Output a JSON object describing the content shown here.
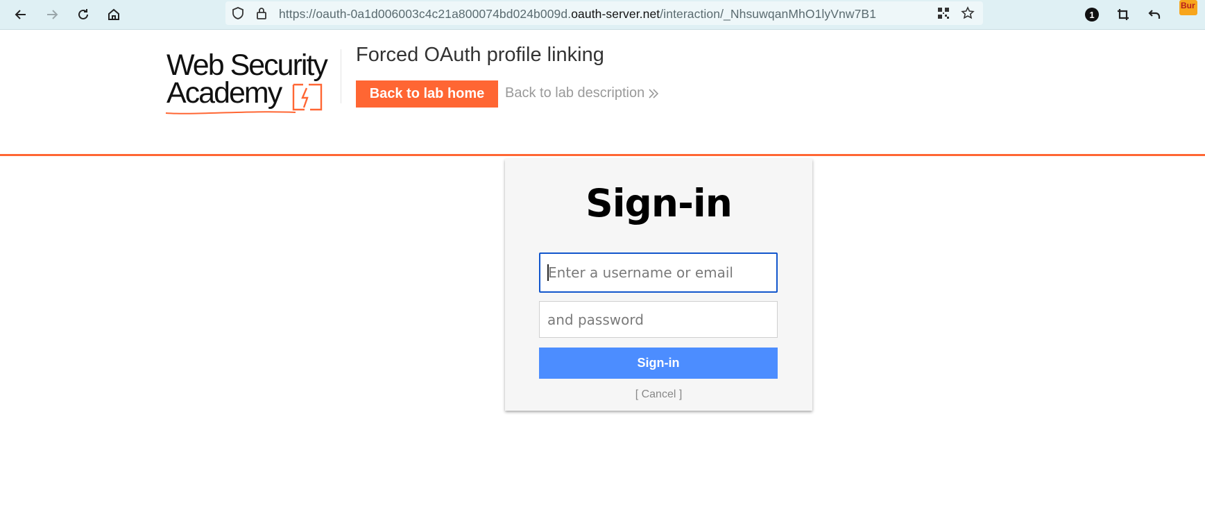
{
  "browser": {
    "url_prefix": "https://oauth-0a1d006003c4c21a800074bd024b009d.",
    "url_domain": "oauth-server.net",
    "url_path": "/interaction/_NhsuwqanMhO1lyVnw7B1",
    "notification_count": "1",
    "extension_label": "Bur"
  },
  "header": {
    "logo_line1": "Web Security",
    "logo_line2": "Academy",
    "lab_title": "Forced OAuth profile linking",
    "back_home_label": "Back to lab home",
    "back_description_label": "Back to lab description",
    "accent_color": "#ff6633"
  },
  "signin": {
    "title": "Sign-in",
    "username_placeholder": "Enter a username or email",
    "password_placeholder": "and password",
    "submit_label": "Sign-in",
    "cancel_label": "[ Cancel ]",
    "button_color": "#4c8dff"
  }
}
